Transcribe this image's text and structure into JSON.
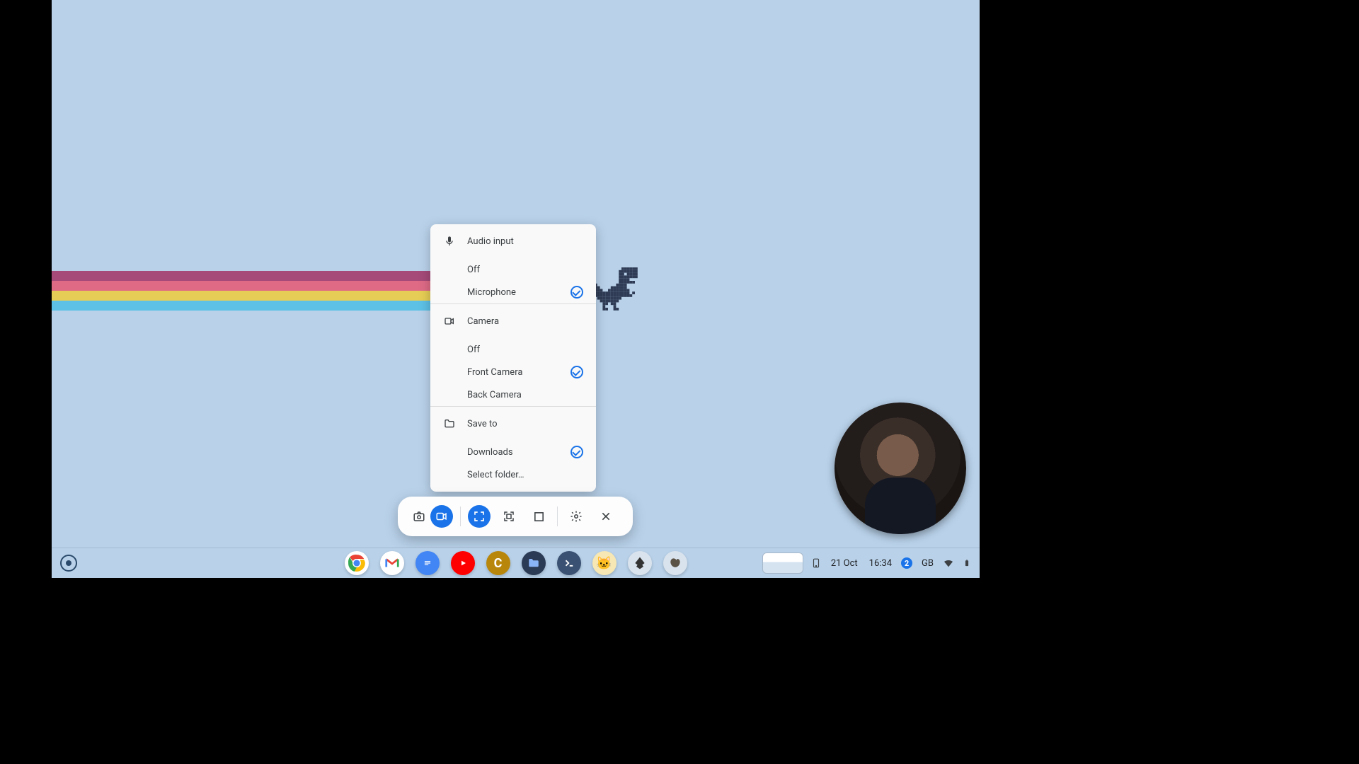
{
  "settings_menu": {
    "audio": {
      "header": "Audio input",
      "options": [
        {
          "label": "Off",
          "selected": false
        },
        {
          "label": "Microphone",
          "selected": true
        }
      ]
    },
    "camera": {
      "header": "Camera",
      "options": [
        {
          "label": "Off",
          "selected": false
        },
        {
          "label": "Front Camera",
          "selected": true
        },
        {
          "label": "Back Camera",
          "selected": false
        }
      ]
    },
    "saveto": {
      "header": "Save to",
      "options": [
        {
          "label": "Downloads",
          "selected": true
        },
        {
          "label": "Select folder…",
          "selected": false
        }
      ]
    }
  },
  "capture_bar": {
    "screenshot_active": false,
    "screencast_active": true,
    "region_full_active": true
  },
  "shelf_apps": [
    {
      "name": "chrome"
    },
    {
      "name": "gmail"
    },
    {
      "name": "docs"
    },
    {
      "name": "youtube"
    },
    {
      "name": "c-app"
    },
    {
      "name": "files"
    },
    {
      "name": "terminal"
    },
    {
      "name": "scratch"
    },
    {
      "name": "inkscape"
    },
    {
      "name": "gimp"
    }
  ],
  "tray": {
    "date": "21 Oct",
    "time": "16:34",
    "notif_count": "2",
    "keyboard": "GB"
  }
}
